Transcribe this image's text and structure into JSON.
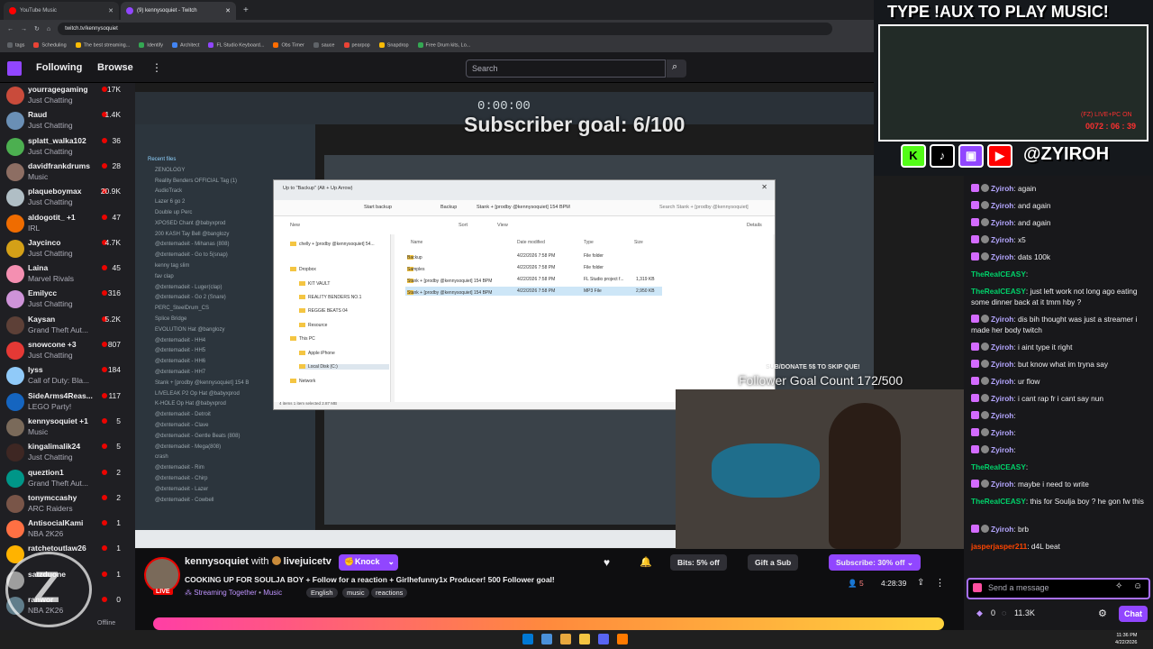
{
  "browser": {
    "tabs": [
      {
        "title": "YouTube Music"
      },
      {
        "title": "(9) kennysoquiet - Twitch"
      }
    ],
    "url": "twitch.tv/kennysoquiet",
    "bookmarks": [
      "tags",
      "Scheduling",
      "The best streaming...",
      "Identify",
      "Architect",
      "FL Studio Keyboard...",
      "Obs Timer",
      "sauce",
      "pearpop",
      "Snapdrop",
      "Free Drum kits, Lo..."
    ]
  },
  "nav": {
    "following": "Following",
    "browse": "Browse",
    "search_placeholder": "Search"
  },
  "sidebar": {
    "channels": [
      {
        "name": "yourragegaming",
        "category": "Just Chatting",
        "viewers": "17K",
        "color": "#c94b3b"
      },
      {
        "name": "Raud",
        "category": "Just Chatting",
        "viewers": "1.4K",
        "color": "#6a8fb5"
      },
      {
        "name": "splatt_walka102",
        "category": "Just Chatting",
        "viewers": "36",
        "color": "#4caf50"
      },
      {
        "name": "davidfrankdrums",
        "category": "Music",
        "viewers": "28",
        "color": "#8d6e63"
      },
      {
        "name": "plaqueboymax",
        "category": "Just Chatting",
        "viewers": "20.9K",
        "color": "#b0bec5"
      },
      {
        "name": "aldogotit_ +1",
        "category": "IRL",
        "viewers": "47",
        "color": "#ef6c00"
      },
      {
        "name": "Jaycinco",
        "category": "Just Chatting",
        "viewers": "4.7K",
        "color": "#d4a017"
      },
      {
        "name": "Laina",
        "category": "Marvel Rivals",
        "viewers": "45",
        "color": "#f48fb1"
      },
      {
        "name": "Emilycc",
        "category": "Just Chatting",
        "viewers": "316",
        "color": "#ce93d8"
      },
      {
        "name": "Kaysan",
        "category": "Grand Theft Aut...",
        "viewers": "5.2K",
        "color": "#5d4037"
      },
      {
        "name": "snowcone +3",
        "category": "Just Chatting",
        "viewers": "807",
        "color": "#e53935"
      },
      {
        "name": "lyss",
        "category": "Call of Duty: Bla...",
        "viewers": "184",
        "color": "#90caf9"
      },
      {
        "name": "SideArms4Reas...",
        "category": "LEGO Party!",
        "viewers": "117",
        "color": "#1565c0"
      },
      {
        "name": "kennysoquiet +1",
        "category": "Music",
        "viewers": "5",
        "color": "#7a6a5a"
      },
      {
        "name": "kingalimalik24",
        "category": "Just Chatting",
        "viewers": "5",
        "color": "#3e2723"
      },
      {
        "name": "queztion1",
        "category": "Grand Theft Aut...",
        "viewers": "2",
        "color": "#009688"
      },
      {
        "name": "tonymccashy",
        "category": "ARC Raiders",
        "viewers": "2",
        "color": "#795548"
      },
      {
        "name": "AntisocialKami",
        "category": "NBA 2K26",
        "viewers": "1",
        "color": "#ff7043"
      },
      {
        "name": "ratchetoutlaw26",
        "category": "",
        "viewers": "1",
        "color": "#ffb300"
      },
      {
        "name": "satzduone",
        "category": "",
        "viewers": "1",
        "color": "#9e9e9e"
      },
      {
        "name": "ranwor",
        "category": "NBA 2K26",
        "viewers": "0",
        "color": "#607d8b"
      }
    ],
    "offline": "Offline"
  },
  "video": {
    "subscriber_goal": "Subscriber goal: 6/100",
    "sub_donate": "SUB/DONATE 5$ TO SKIP QUE!",
    "follower_goal": "Follower Goal Count 172/500",
    "fl_time": "0:00:00",
    "explorer": {
      "title": "Up to \"Backup\" (Alt + Up Arrow)",
      "breadcrumb": [
        "Start backup",
        "Backup",
        "Stank + [prodby @kennysoquiet] 154 BPM"
      ],
      "search": "Search Stank + [prodby @kennysoquiet]",
      "toolbar": [
        "New",
        "Sort",
        "View",
        "Details"
      ],
      "columns": [
        "Name",
        "Date modified",
        "Type",
        "Size"
      ],
      "rows": [
        {
          "name": "Backup",
          "date": "4/22/2026 7:58 PM",
          "type": "File folder",
          "size": ""
        },
        {
          "name": "Samples",
          "date": "4/22/2026 7:58 PM",
          "type": "File folder",
          "size": ""
        },
        {
          "name": "Stank + [prodby @kennysoquiet] 154 BPM",
          "date": "4/22/2026 7:58 PM",
          "type": "FL Studio project f...",
          "size": "1,319 KB"
        },
        {
          "name": "Stank + [prodby @kennysoquiet] 154 BPM",
          "date": "4/22/2026 7:58 PM",
          "type": "MP3 File",
          "size": "2,950 KB"
        }
      ],
      "tree": [
        "chelly + [prodby @kennysoquiet] 54...",
        "Dropbox",
        "KIT VAULT",
        "REALITY BENDERS NO.1",
        "REGGIE BEATS 04",
        "Resource",
        "This PC",
        "Apple iPhone",
        "Local Disk (C:)",
        "Network"
      ],
      "status": "4 items    1 item selected  2.87 MB"
    },
    "fl_browser_items": [
      "Recent files",
      "ZENOLOGY",
      "Reality Benders OFFICIAL Tag (1)",
      "AudioTrack",
      "Lazer 6 go 2",
      "Double up Perc",
      "XPOSED Chant @babyxprod",
      "200 KASH Tay Bell @banglozy",
      "@dxntemadeit - Mihanas (808)",
      "@dxntemadeit - Go to 5(snap)",
      "kenny tag slim",
      "fav clap",
      "@dxntemadeit - Luger(clap)",
      "@dxntemadeit - Go 2 (Snare)",
      "PERC_SteelDrum_CS",
      "Splice Bridge",
      "EVOLUTION Hat @banglozy",
      "@dxntemadeit - HH4",
      "@dxntemadeit - HH5",
      "@dxntemadeit - HH6",
      "@dxntemadeit - HH7",
      "Stank + [prodby @kennysoquiet] 154 B",
      "LIVELEAK P2 Op Hat @babyxprod",
      "K-HOLE Op Hat @babyxprod",
      "@dxntemadeit - Detroit",
      "@dxntemadeit - Clave",
      "@dxntemadeit - Gentle Beats (808)",
      "@dxntemadeit - Mega(808)",
      "crash",
      "@dxntemadeit - Rim",
      "@dxntemadeit - Chirp",
      "@dxntemadeit - Lazer",
      "@dxntemadeit - Cowbell"
    ]
  },
  "overlay": {
    "title": "TYPE !AUX TO PLAY MUSIC!",
    "handle": "@ZYIROH",
    "live": "(FZ) LIVE+PC ON",
    "time": "0072 : 06 : 39",
    "socials": [
      "K",
      "tiktok",
      "twitch",
      "youtube"
    ]
  },
  "chat": {
    "messages": [
      {
        "user": "Zyiroh",
        "text": "again",
        "color": "#b4a6ff"
      },
      {
        "user": "Zyiroh",
        "text": "and again",
        "color": "#b4a6ff"
      },
      {
        "user": "Zyiroh",
        "text": "and again",
        "color": "#b4a6ff"
      },
      {
        "user": "Zyiroh",
        "text": "x5",
        "color": "#b4a6ff"
      },
      {
        "user": "Zyiroh",
        "text": "dats 100k",
        "color": "#b4a6ff"
      },
      {
        "user": "TheRealCEASY",
        "text": "",
        "color": "#00d26a"
      },
      {
        "user": "TheRealCEASY",
        "text": "just left work not long ago eating some dinner back at it tmm hby ?",
        "color": "#00d26a"
      },
      {
        "user": "Zyiroh",
        "text": "dis bih thought was just a streamer i made her body twitch",
        "color": "#b4a6ff"
      },
      {
        "user": "Zyiroh",
        "text": "i aint type it right",
        "color": "#b4a6ff"
      },
      {
        "user": "Zyiroh",
        "text": "but know what im tryna say",
        "color": "#b4a6ff"
      },
      {
        "user": "Zyiroh",
        "text": "ur flow",
        "color": "#b4a6ff"
      },
      {
        "user": "Zyiroh",
        "text": "i cant rap fr i cant say nun",
        "color": "#b4a6ff"
      },
      {
        "user": "Zyiroh",
        "text": "",
        "color": "#b4a6ff"
      },
      {
        "user": "Zyiroh",
        "text": "",
        "color": "#b4a6ff"
      },
      {
        "user": "Zyiroh",
        "text": "",
        "color": "#b4a6ff"
      },
      {
        "user": "TheRealCEASY",
        "text": "",
        "color": "#00d26a"
      },
      {
        "user": "Zyiroh",
        "text": "maybe i need to write",
        "color": "#b4a6ff"
      },
      {
        "user": "TheRealCEASY",
        "text": "this for Soulja boy ? he gon fw this",
        "color": "#00d26a"
      },
      {
        "user": "Zyiroh",
        "text": "brb",
        "color": "#b4a6ff"
      },
      {
        "user": "jasperjasper211",
        "text": "d4L beat",
        "color": "#ff4500"
      }
    ],
    "input_placeholder": "Send a message",
    "points": "0",
    "channel_points": "11.3K",
    "chat_button": "Chat"
  },
  "stream": {
    "streamer": "kennysoquiet",
    "with": "with",
    "collab": "livejuicetv",
    "knock": "Knock",
    "title": "COOKING UP FOR SOULJA BOY + Follow for a reaction + Girlhefunny1x Producer! 500 Follower goal!",
    "together": "Streaming Together",
    "category": "Music",
    "tags": [
      "English",
      "music",
      "reactions"
    ],
    "bits": "Bits: 5% off",
    "gift": "Gift a Sub",
    "subscribe": "Subscribe: 30% off",
    "viewers": "5",
    "uptime": "4:28:39",
    "live": "LIVE"
  },
  "taskbar": {
    "time": "11:36 PM",
    "date": "4/22/2026"
  }
}
